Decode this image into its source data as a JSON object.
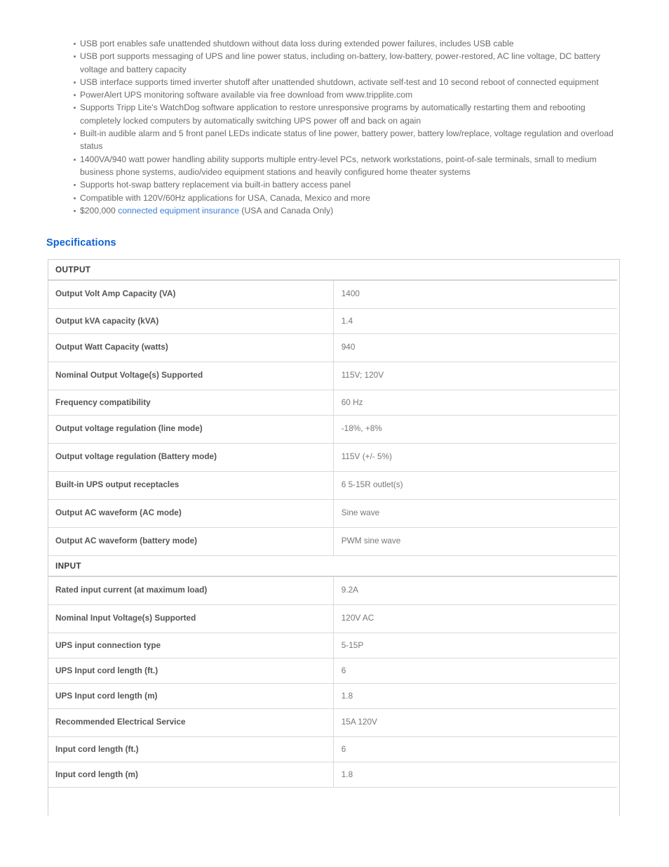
{
  "features": [
    {
      "parts": [
        {
          "type": "text",
          "value": "USB port enables safe unattended shutdown without data loss during extended power failures, includes USB cable"
        }
      ]
    },
    {
      "parts": [
        {
          "type": "text",
          "value": "USB port supports messaging of UPS and line power status, including on-battery, low-battery, power-restored, AC line voltage, DC battery voltage and battery capacity"
        }
      ]
    },
    {
      "parts": [
        {
          "type": "text",
          "value": "USB interface supports timed inverter shutoff after unattended shutdown, activate self-test and 10 second reboot of connected equipment"
        }
      ]
    },
    {
      "parts": [
        {
          "type": "text",
          "value": "PowerAlert UPS monitoring software available via free download from www.tripplite.com"
        }
      ]
    },
    {
      "parts": [
        {
          "type": "text",
          "value": "Supports Tripp Lite's WatchDog software application to restore unresponsive programs by automatically restarting them and rebooting completely locked computers by automatically switching UPS power off and back on again"
        }
      ]
    },
    {
      "parts": [
        {
          "type": "text",
          "value": "Built-in audible alarm and 5 front panel LEDs indicate status of line power, battery power, battery low/replace, voltage regulation and overload status"
        }
      ]
    },
    {
      "parts": [
        {
          "type": "text",
          "value": "1400VA/940 watt power handling ability supports multiple entry-level PCs, network workstations, point-of-sale terminals, small to medium business phone systems, audio/video equipment stations and heavily configured home theater systems"
        }
      ]
    },
    {
      "parts": [
        {
          "type": "text",
          "value": "Supports hot-swap battery replacement via built-in battery access panel"
        }
      ]
    },
    {
      "parts": [
        {
          "type": "text",
          "value": "Compatible with 120V/60Hz applications for USA, Canada, Mexico and more"
        }
      ]
    },
    {
      "parts": [
        {
          "type": "text",
          "value": "$200,000 "
        },
        {
          "type": "link",
          "value": "connected equipment insurance"
        },
        {
          "type": "text",
          "value": " (USA and Canada Only)"
        }
      ]
    }
  ],
  "specifications": {
    "heading": "Specifications",
    "sections": [
      {
        "title": "OUTPUT",
        "rows": [
          {
            "label": "Output Volt Amp Capacity (VA)",
            "value": "1400",
            "tall": true
          },
          {
            "label": "Output kVA capacity (kVA)",
            "value": "1.4",
            "tall": false
          },
          {
            "label": "Output Watt Capacity (watts)",
            "value": "940",
            "tall": true
          },
          {
            "label": "Nominal Output Voltage(s) Supported",
            "value": "115V; 120V",
            "tall": true
          },
          {
            "label": "Frequency compatibility",
            "value": "60 Hz",
            "tall": false
          },
          {
            "label": "Output voltage regulation (line mode)",
            "value": "-18%, +8%",
            "tall": true
          },
          {
            "label": "Output voltage regulation (Battery mode)",
            "value": "115V (+/- 5%)",
            "tall": true
          },
          {
            "label": "Built-in UPS output receptacles",
            "value": "6 5-15R outlet(s)",
            "tall": true
          },
          {
            "label": "Output AC waveform (AC mode)",
            "value": "Sine wave",
            "tall": true
          },
          {
            "label": "Output AC waveform (battery mode)",
            "value": "PWM sine wave",
            "tall": true
          }
        ]
      },
      {
        "title": "INPUT",
        "rows": [
          {
            "label": "Rated input current (at maximum load)",
            "value": "9.2A",
            "tall": true
          },
          {
            "label": "Nominal Input Voltage(s) Supported",
            "value": "120V AC",
            "tall": true
          },
          {
            "label": "UPS input connection type",
            "value": "5-15P",
            "tall": false
          },
          {
            "label": "UPS Input cord length (ft.)",
            "value": "6",
            "tall": false
          },
          {
            "label": "UPS Input cord length (m)",
            "value": "1.8",
            "tall": false
          },
          {
            "label": "Recommended Electrical Service",
            "value": "15A 120V",
            "tall": true
          },
          {
            "label": "Input cord length (ft.)",
            "value": "6",
            "tall": false
          },
          {
            "label": "Input cord length (m)",
            "value": "1.8",
            "tall": false
          }
        ]
      }
    ]
  },
  "colors": {
    "link": "#3b7dd8",
    "heading": "#0d62d0",
    "body_text": "#6a6a6a",
    "label_text": "#555555",
    "value_text": "#777777",
    "border": "#d9d9d9"
  }
}
